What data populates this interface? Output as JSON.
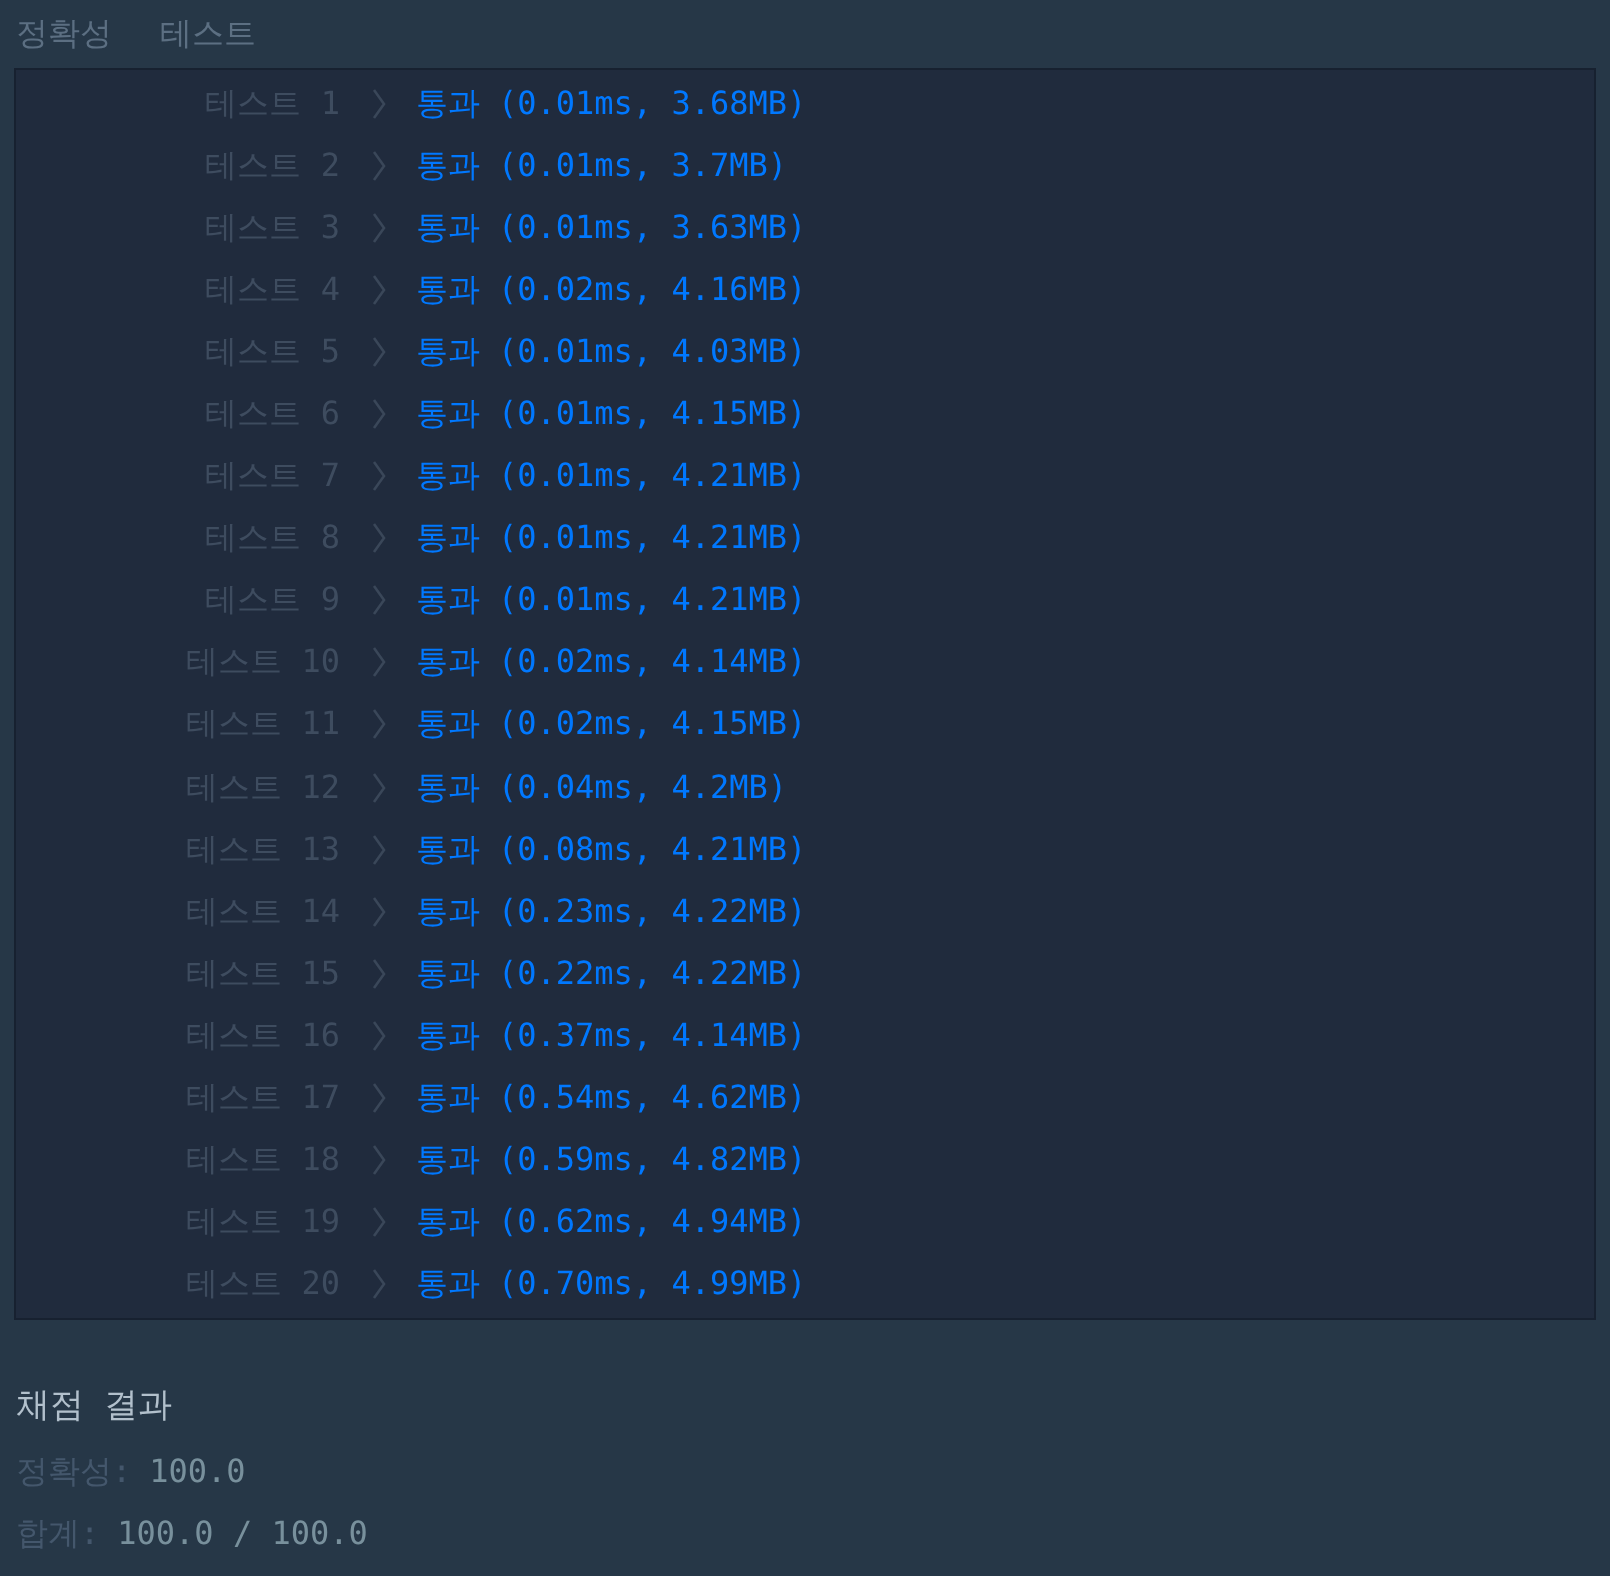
{
  "section_title": {
    "label": "정확성",
    "title": "테스트"
  },
  "tests": [
    {
      "label": "테스트 1",
      "status": "통과",
      "detail": "(0.01ms, 3.68MB)"
    },
    {
      "label": "테스트 2",
      "status": "통과",
      "detail": "(0.01ms, 3.7MB)"
    },
    {
      "label": "테스트 3",
      "status": "통과",
      "detail": "(0.01ms, 3.63MB)"
    },
    {
      "label": "테스트 4",
      "status": "통과",
      "detail": "(0.02ms, 4.16MB)"
    },
    {
      "label": "테스트 5",
      "status": "통과",
      "detail": "(0.01ms, 4.03MB)"
    },
    {
      "label": "테스트 6",
      "status": "통과",
      "detail": "(0.01ms, 4.15MB)"
    },
    {
      "label": "테스트 7",
      "status": "통과",
      "detail": "(0.01ms, 4.21MB)"
    },
    {
      "label": "테스트 8",
      "status": "통과",
      "detail": "(0.01ms, 4.21MB)"
    },
    {
      "label": "테스트 9",
      "status": "통과",
      "detail": "(0.01ms, 4.21MB)"
    },
    {
      "label": "테스트 10",
      "status": "통과",
      "detail": "(0.02ms, 4.14MB)"
    },
    {
      "label": "테스트 11",
      "status": "통과",
      "detail": "(0.02ms, 4.15MB)"
    },
    {
      "label": "테스트 12",
      "status": "통과",
      "detail": "(0.04ms, 4.2MB)"
    },
    {
      "label": "테스트 13",
      "status": "통과",
      "detail": "(0.08ms, 4.21MB)"
    },
    {
      "label": "테스트 14",
      "status": "통과",
      "detail": "(0.23ms, 4.22MB)"
    },
    {
      "label": "테스트 15",
      "status": "통과",
      "detail": "(0.22ms, 4.22MB)"
    },
    {
      "label": "테스트 16",
      "status": "통과",
      "detail": "(0.37ms, 4.14MB)"
    },
    {
      "label": "테스트 17",
      "status": "통과",
      "detail": "(0.54ms, 4.62MB)"
    },
    {
      "label": "테스트 18",
      "status": "통과",
      "detail": "(0.59ms, 4.82MB)"
    },
    {
      "label": "테스트 19",
      "status": "통과",
      "detail": "(0.62ms, 4.94MB)"
    },
    {
      "label": "테스트 20",
      "status": "통과",
      "detail": "(0.70ms, 4.99MB)"
    }
  ],
  "result": {
    "title": "채점 결과",
    "lines": [
      {
        "label": "정확성:",
        "value": "100.0"
      },
      {
        "label": "합계:",
        "value": "100.0 / 100.0"
      }
    ]
  }
}
